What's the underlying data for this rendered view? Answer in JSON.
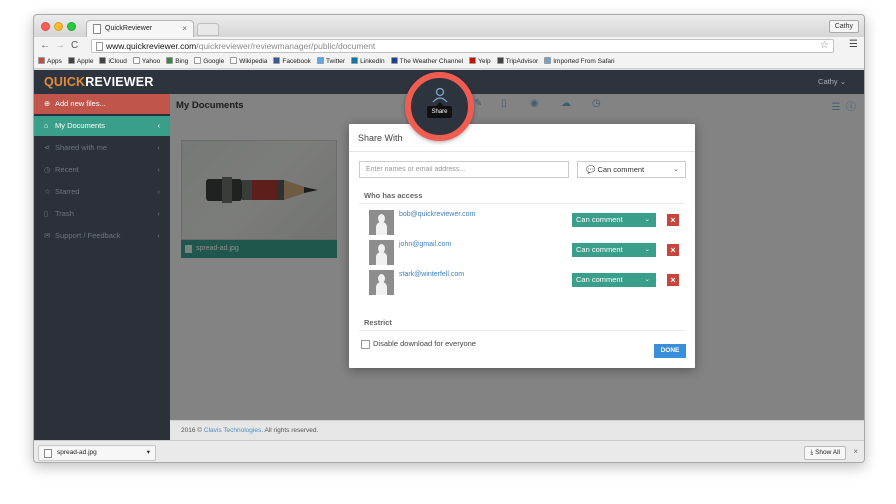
{
  "browser": {
    "tab_title": "QuickReviewer",
    "tab_close": "×",
    "profile_name": "Cathy",
    "url_domain": "www.quickreviewer.com",
    "url_path": "/quickreviewer/reviewmanager/public/document",
    "bookmarks": [
      {
        "label": "Apps",
        "icon_color": "#d04a3a"
      },
      {
        "label": "Apple",
        "icon_color": "#444444"
      },
      {
        "label": "iCloud",
        "icon_color": "#444444"
      },
      {
        "label": "Yahoo",
        "icon_color": "#ffffff"
      },
      {
        "label": "Bing",
        "icon_color": "#2d8a3e"
      },
      {
        "label": "Google",
        "icon_color": "#ffffff"
      },
      {
        "label": "Wikipedia",
        "icon_color": "#ffffff"
      },
      {
        "label": "Facebook",
        "icon_color": "#3b5998"
      },
      {
        "label": "Twitter",
        "icon_color": "#55acee"
      },
      {
        "label": "LinkedIn",
        "icon_color": "#0e76a8"
      },
      {
        "label": "The Weather Channel",
        "icon_color": "#1c3f8f"
      },
      {
        "label": "Yelp",
        "icon_color": "#c41200"
      },
      {
        "label": "TripAdvisor",
        "icon_color": "#444444"
      },
      {
        "label": "Imported From Safari",
        "icon_color": "#6fa0d8"
      }
    ]
  },
  "app": {
    "logo_quick": "QUICK",
    "logo_reviewer": "REVIEWER",
    "user_menu": "Cathy ⌄",
    "add_files": "Add new files...",
    "sidebar": [
      {
        "label": "My Documents",
        "icon": "home-icon"
      },
      {
        "label": "Shared with me",
        "icon": "share-icon"
      },
      {
        "label": "Recent",
        "icon": "clock-icon"
      },
      {
        "label": "Starred",
        "icon": "star-icon"
      },
      {
        "label": "Trash",
        "icon": "trash-icon"
      },
      {
        "label": "Support / Feedback",
        "icon": "support-icon"
      }
    ],
    "page_title": "My Documents",
    "thumbnail_caption": "spread-ad.jpg",
    "footer_text": "2016 ©",
    "footer_link": "Clavis Technologies",
    "footer_suffix": ". All rights reserved.",
    "accent_color": "#3a9f8a",
    "danger_color": "#c0554b"
  },
  "share_highlight": {
    "tooltip": "Share",
    "ring_color": "#ef5d52"
  },
  "share_modal": {
    "title": "Share With",
    "input_placeholder": "Enter names or email address...",
    "permission_label": "Can comment",
    "who_has_access": "Who has access",
    "people": [
      {
        "email": "bob@quickreviewer.com",
        "role": "Can comment"
      },
      {
        "email": "john@gmail.com",
        "role": "Can comment"
      },
      {
        "email": "stark@winterfell.com",
        "role": "Can comment"
      }
    ],
    "restrict_heading": "Restrict",
    "disable_download_label": "Disable download for everyone",
    "done_label": "DONE"
  },
  "downloads": {
    "file_name": "spread-ad.jpg",
    "show_all": "Show All"
  }
}
